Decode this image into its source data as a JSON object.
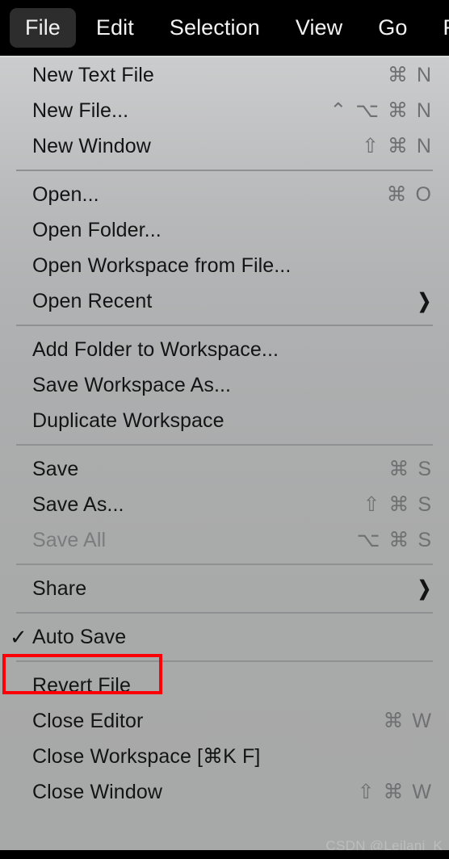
{
  "menubar": {
    "items": [
      {
        "label": "File",
        "active": true
      },
      {
        "label": "Edit",
        "active": false
      },
      {
        "label": "Selection",
        "active": false
      },
      {
        "label": "View",
        "active": false
      },
      {
        "label": "Go",
        "active": false
      },
      {
        "label": "R",
        "active": false
      }
    ]
  },
  "menu": {
    "groups": [
      {
        "rows": [
          {
            "label": "New Text File",
            "shortcut": "⌘ N",
            "type": "item"
          },
          {
            "label": "New File...",
            "shortcut": "⌃ ⌥ ⌘ N",
            "type": "item"
          },
          {
            "label": "New Window",
            "shortcut": "⇧ ⌘ N",
            "type": "item"
          }
        ]
      },
      {
        "rows": [
          {
            "label": "Open...",
            "shortcut": "⌘ O",
            "type": "item"
          },
          {
            "label": "Open Folder...",
            "shortcut": "",
            "type": "item"
          },
          {
            "label": "Open Workspace from File...",
            "shortcut": "",
            "type": "item"
          },
          {
            "label": "Open Recent",
            "shortcut": "",
            "type": "submenu"
          }
        ]
      },
      {
        "rows": [
          {
            "label": "Add Folder to Workspace...",
            "shortcut": "",
            "type": "item"
          },
          {
            "label": "Save Workspace As...",
            "shortcut": "",
            "type": "item"
          },
          {
            "label": "Duplicate Workspace",
            "shortcut": "",
            "type": "item"
          }
        ]
      },
      {
        "rows": [
          {
            "label": "Save",
            "shortcut": "⌘ S",
            "type": "item"
          },
          {
            "label": "Save As...",
            "shortcut": "⇧ ⌘ S",
            "type": "item"
          },
          {
            "label": "Save All",
            "shortcut": "⌥ ⌘ S",
            "type": "item",
            "disabled": true
          }
        ]
      },
      {
        "rows": [
          {
            "label": "Share",
            "shortcut": "",
            "type": "submenu"
          }
        ]
      },
      {
        "rows": [
          {
            "label": "Auto Save",
            "shortcut": "",
            "type": "checked",
            "check": "✓"
          }
        ]
      },
      {
        "rows": [
          {
            "label": "Revert File",
            "shortcut": "",
            "type": "item"
          },
          {
            "label": "Close Editor",
            "shortcut": "⌘ W",
            "type": "item"
          },
          {
            "label": "Close Workspace [⌘K F]",
            "shortcut": "",
            "type": "item"
          },
          {
            "label": "Close Window",
            "shortcut": "⇧ ⌘ W",
            "type": "item"
          }
        ]
      }
    ]
  },
  "annotation": {
    "target": "Auto Save",
    "color": "#fb0007"
  },
  "watermark": {
    "text": "CSDN @Leilani_K"
  },
  "colors": {
    "menubar_bg": "#000000",
    "menubar_active_bg": "#2d2d2d",
    "menu_text": "#141414",
    "menu_disabled_text": "#7b7c7d",
    "shortcut_text": "#6f7071",
    "separator": "#8f9091",
    "annotation_red": "#fb0007"
  }
}
